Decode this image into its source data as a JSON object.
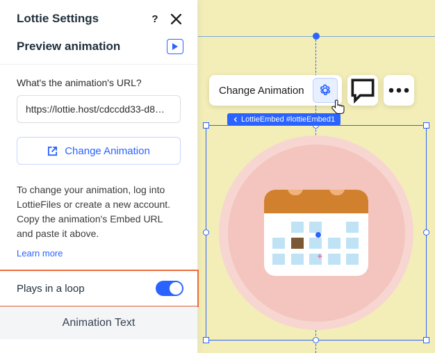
{
  "panel": {
    "title": "Lottie Settings",
    "preview_label": "Preview animation",
    "url_question": "What's the animation's URL?",
    "url_value": "https://lottie.host/cdccdd33-d8…",
    "change_button": "Change Animation",
    "help_text": "To change your animation, log into LottieFiles or create a new account. Copy the animation's Embed URL and paste it above.",
    "learn_more": "Learn more",
    "loop_label": "Plays in a loop",
    "loop_on": true,
    "animation_text_label": "Animation Text"
  },
  "canvas": {
    "toolbar_label": "Change Animation",
    "element_tag": "LottieEmbed #lottieEmbed1"
  }
}
